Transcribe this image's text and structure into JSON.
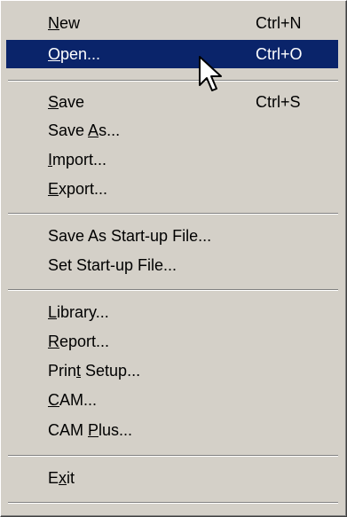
{
  "menu": {
    "items": [
      {
        "label": "New",
        "mnemonic": 0,
        "shortcut": "Ctrl+N"
      },
      {
        "label": "Open...",
        "mnemonic": 0,
        "shortcut": "Ctrl+O"
      },
      {
        "label": "Save",
        "mnemonic": 0,
        "shortcut": "Ctrl+S"
      },
      {
        "label": "Save As...",
        "mnemonic": 5,
        "shortcut": ""
      },
      {
        "label": "Import...",
        "mnemonic": 0,
        "shortcut": ""
      },
      {
        "label": "Export...",
        "mnemonic": 0,
        "shortcut": ""
      },
      {
        "label": "Save As Start-up File...",
        "mnemonic": -1,
        "shortcut": ""
      },
      {
        "label": "Set Start-up File...",
        "mnemonic": -1,
        "shortcut": ""
      },
      {
        "label": "Library...",
        "mnemonic": 0,
        "shortcut": ""
      },
      {
        "label": "Report...",
        "mnemonic": 0,
        "shortcut": ""
      },
      {
        "label": "Print Setup...",
        "mnemonic": 4,
        "shortcut": ""
      },
      {
        "label": "CAM...",
        "mnemonic": 0,
        "shortcut": ""
      },
      {
        "label": "CAM Plus...",
        "mnemonic": 4,
        "shortcut": ""
      },
      {
        "label": "Exit",
        "mnemonic": 1,
        "shortcut": ""
      }
    ],
    "highlighted_item": "Open...",
    "highlight_color": "#0a246a",
    "icons": [
      "mouse-pointer-icon"
    ]
  }
}
